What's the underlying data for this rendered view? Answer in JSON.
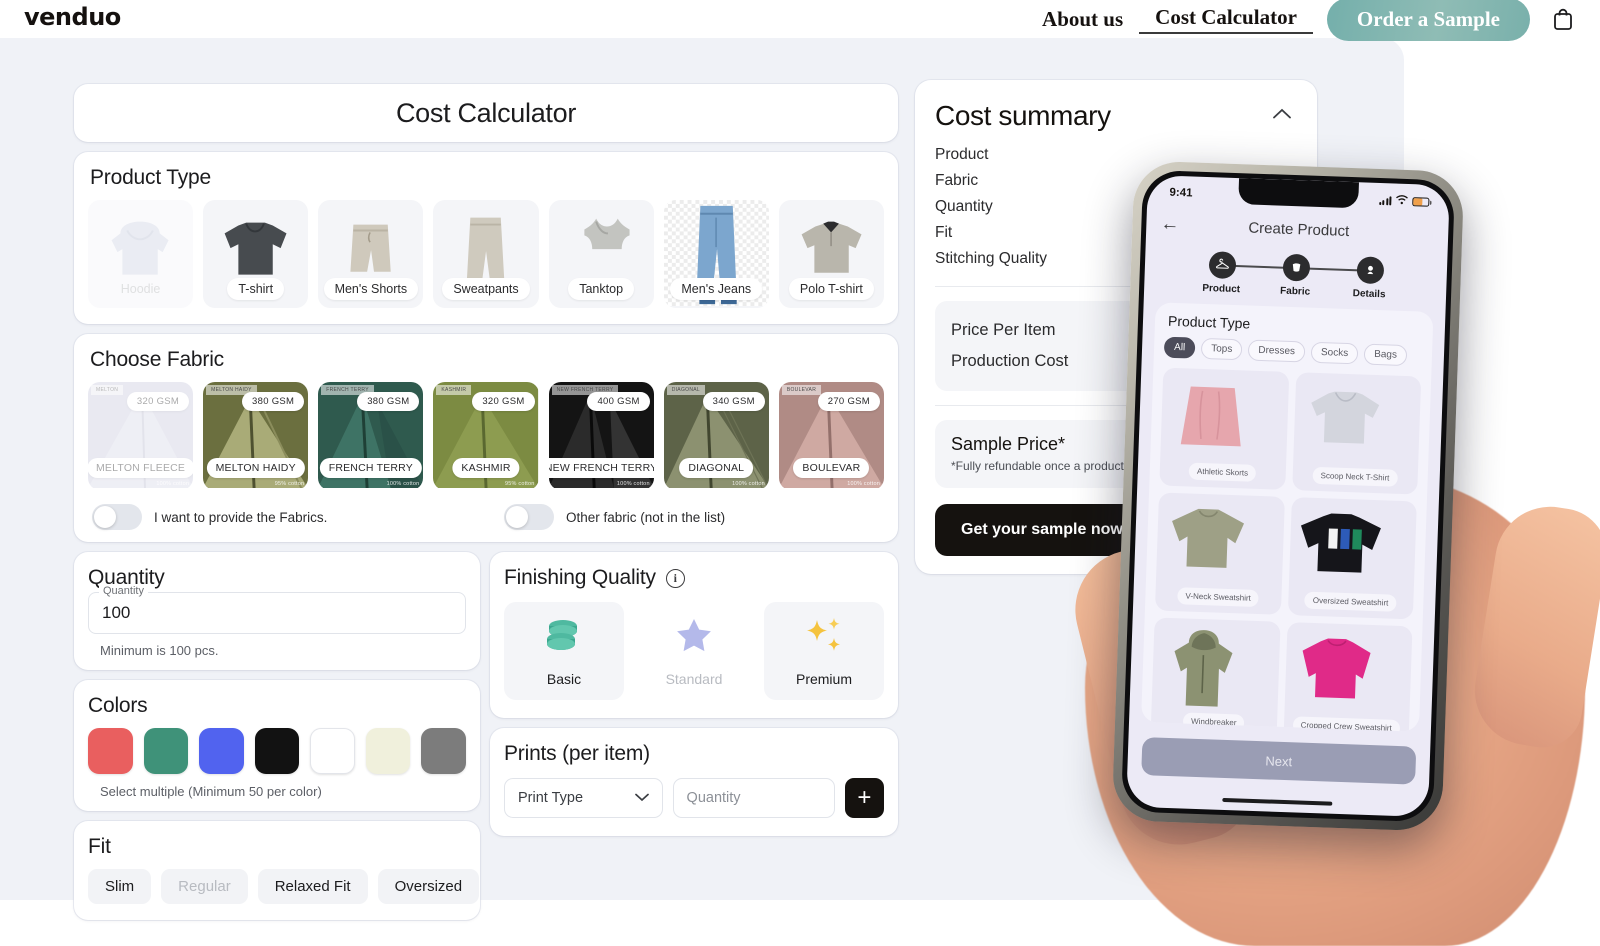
{
  "header": {
    "logo": "venduo",
    "nav": [
      {
        "label": "About us",
        "active": false
      },
      {
        "label": "Cost Calculator",
        "active": true
      }
    ],
    "order_button": "Order a Sample",
    "cart_icon": "shopping-bag-icon"
  },
  "calculator": {
    "title": "Cost Calculator",
    "product_type": {
      "title": "Product Type",
      "items": [
        {
          "label": "Hoodie",
          "disabled": true
        },
        {
          "label": "T-shirt",
          "disabled": false
        },
        {
          "label": "Men's Shorts",
          "disabled": false
        },
        {
          "label": "Sweatpants",
          "disabled": false
        },
        {
          "label": "Tanktop",
          "disabled": false
        },
        {
          "label": "Men's Jeans",
          "disabled": false
        },
        {
          "label": "Polo T-shirt",
          "disabled": false
        }
      ]
    },
    "fabric": {
      "title": "Choose Fabric",
      "items": [
        {
          "name": "MELTON FLEECE",
          "gsm": "320 GSM",
          "tag": "MELTON",
          "composition": "100% cotton",
          "disabled": true
        },
        {
          "name": "MELTON HAIDY",
          "gsm": "380 GSM",
          "tag": "MELTON HAIDY",
          "composition": "95% cotton",
          "disabled": false
        },
        {
          "name": "FRENCH TERRY",
          "gsm": "380 GSM",
          "tag": "FRENCH TERRY",
          "composition": "100% cotton",
          "disabled": false
        },
        {
          "name": "KASHMIR",
          "gsm": "320 GSM",
          "tag": "KASHMIR",
          "composition": "95% cotton",
          "disabled": false
        },
        {
          "name": "NEW FRENCH TERRY",
          "gsm": "400 GSM",
          "tag": "NEW FRENCH TERRY",
          "composition": "100% cotton",
          "disabled": false
        },
        {
          "name": "DIAGONAL",
          "gsm": "340 GSM",
          "tag": "DIAGONAL",
          "composition": "100% cotton",
          "disabled": false
        },
        {
          "name": "BOULEVAR",
          "gsm": "270 GSM",
          "tag": "BOULEVAR",
          "composition": "100% cotton",
          "disabled": false
        }
      ],
      "toggle_provide_fabric": "I want to provide the Fabrics.",
      "toggle_other_fabric": "Other fabric (not in the list)"
    },
    "quantity": {
      "title": "Quantity",
      "field_label": "Quantity",
      "value": "100",
      "hint": "Minimum is 100 pcs."
    },
    "colors": {
      "title": "Colors",
      "hint": "Select multiple (Minimum 50 per color)",
      "swatches": [
        {
          "name": "coral-red",
          "hex": "#e95f5f"
        },
        {
          "name": "teal-green",
          "hex": "#3f9279"
        },
        {
          "name": "royal-blue",
          "hex": "#5163ef"
        },
        {
          "name": "black",
          "hex": "#121212"
        },
        {
          "name": "white",
          "hex": "#ffffff"
        },
        {
          "name": "cream",
          "hex": "#f0f0dc"
        },
        {
          "name": "grey",
          "hex": "#7c7c7c"
        }
      ]
    },
    "fit": {
      "title": "Fit",
      "options": [
        {
          "label": "Slim",
          "disabled": false
        },
        {
          "label": "Regular",
          "disabled": true
        },
        {
          "label": "Relaxed Fit",
          "disabled": false
        },
        {
          "label": "Oversized",
          "disabled": false
        }
      ]
    },
    "finishing_quality": {
      "title": "Finishing Quality",
      "info_icon": "info-icon",
      "options": [
        {
          "label": "Basic",
          "icon": "coins-icon",
          "disabled": false
        },
        {
          "label": "Standard",
          "icon": "star-icon",
          "disabled": true
        },
        {
          "label": "Premium",
          "icon": "sparkles-icon",
          "disabled": false
        }
      ]
    },
    "prints": {
      "title": "Prints (per item)",
      "print_type_placeholder": "Print Type",
      "quantity_placeholder": "Quantity",
      "add_button": "+"
    }
  },
  "summary": {
    "title": "Cost summary",
    "collapse_icon": "chevron-up-icon",
    "rows": [
      {
        "label": "Product",
        "value": ""
      },
      {
        "label": "Fabric",
        "value": ""
      },
      {
        "label": "Quantity",
        "value": ""
      },
      {
        "label": "Fit",
        "value": ""
      },
      {
        "label": "Stitching Quality",
        "value": ""
      }
    ],
    "price_rows": [
      {
        "label": "Price Per Item",
        "value": ""
      },
      {
        "label": "Production Cost",
        "value": ""
      }
    ],
    "sample": {
      "title": "Sample Price*",
      "note": "*Fully refundable once a production order is placed."
    },
    "cta_primary": "Get your sample now!",
    "cta_secondary": ""
  },
  "phone": {
    "status_time": "9:41",
    "nav_title": "Create Product",
    "back_icon": "arrow-left-icon",
    "steps": [
      {
        "label": "Product",
        "icon": "hanger-icon"
      },
      {
        "label": "Fabric",
        "icon": "fabric-icon"
      },
      {
        "label": "Details",
        "icon": "details-icon"
      }
    ],
    "panel_title": "Product Type",
    "chips": [
      {
        "label": "All",
        "selected": true
      },
      {
        "label": "Tops",
        "selected": false
      },
      {
        "label": "Dresses",
        "selected": false
      },
      {
        "label": "Socks",
        "selected": false
      },
      {
        "label": "Bags",
        "selected": false
      }
    ],
    "tiles": [
      {
        "label": "Athletic Skorts"
      },
      {
        "label": "Scoop Neck T-Shirt"
      },
      {
        "label": "V-Neck Sweatshirt"
      },
      {
        "label": "Oversized Sweatshirt"
      },
      {
        "label": "Windbreaker"
      },
      {
        "label": "Cropped Crew Sweatshirt"
      }
    ],
    "next_button": "Next"
  }
}
